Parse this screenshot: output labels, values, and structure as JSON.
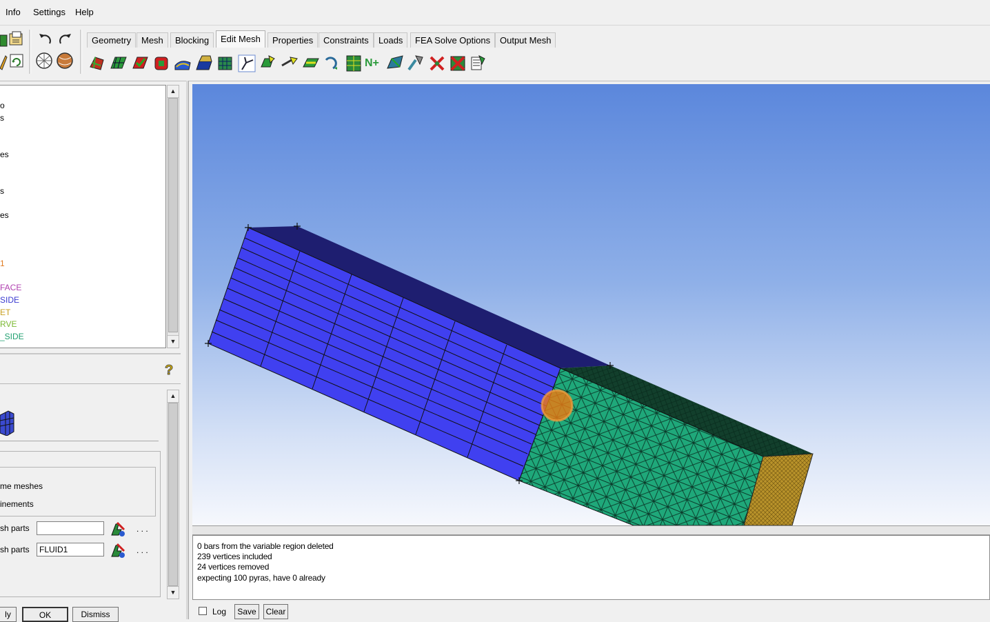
{
  "menu": {
    "items": [
      "Info",
      "Settings",
      "Help"
    ]
  },
  "tabs": [
    {
      "label": "Geometry",
      "active": false
    },
    {
      "label": "Mesh",
      "active": false
    },
    {
      "label": "Blocking",
      "active": false
    },
    {
      "label": "Edit Mesh",
      "active": true
    },
    {
      "label": "Properties",
      "active": false
    },
    {
      "label": "Constraints",
      "active": false
    },
    {
      "label": "Loads",
      "active": false
    },
    {
      "label": "FEA Solve Options",
      "active": false
    },
    {
      "label": "Output Mesh",
      "active": false
    }
  ],
  "tree": {
    "items": [
      {
        "text": "o",
        "color": "#000000"
      },
      {
        "text": "s",
        "color": "#000000"
      },
      {
        "text": "es",
        "color": "#000000"
      },
      {
        "text": "s",
        "color": "#000000"
      },
      {
        "text": "es",
        "color": "#000000"
      },
      {
        "text": "1",
        "color": "#e07a20"
      },
      {
        "text": "FACE",
        "color": "#b040b0"
      },
      {
        "text": "SIDE",
        "color": "#3a3ad0"
      },
      {
        "text": "ET",
        "color": "#c8a020"
      },
      {
        "text": "RVE",
        "color": "#7ab830"
      },
      {
        "text": "_SIDE",
        "color": "#20a070"
      }
    ]
  },
  "options": {
    "check1_label": "me meshes",
    "check2_label": "inements",
    "field1_label": "sh parts",
    "field1_value": "",
    "field2_label": "sh parts",
    "field2_value": "FLUID1",
    "ellipsis": ". . ."
  },
  "buttons": {
    "apply": "ly",
    "ok": "OK",
    "dismiss": "Dismiss"
  },
  "messages": {
    "lines": [
      "0 bars from the variable region deleted",
      "239 vertices included",
      "24 vertices removed",
      "expecting 100 pyras, have 0 already"
    ],
    "log_label": "Log",
    "save_label": "Save",
    "clear_label": "Clear"
  },
  "colors": {
    "hexa_face": "#4040f0",
    "tetra_face": "#1fa87a",
    "top_face": "#1e1e70",
    "end_face": "#b8922a",
    "cursor": "#f07a10"
  }
}
